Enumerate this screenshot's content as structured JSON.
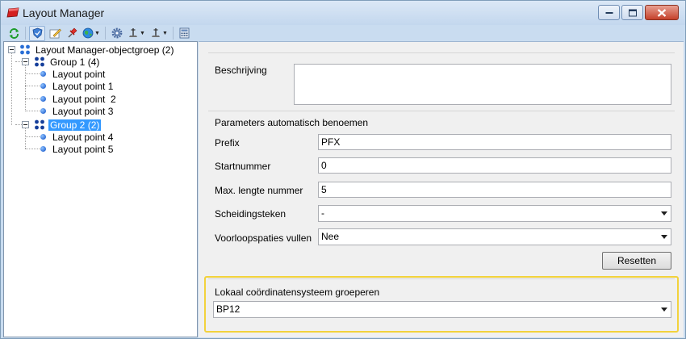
{
  "window": {
    "title": "Layout Manager",
    "icon": "layout-manager-app-icon"
  },
  "toolbar": {
    "buttons": [
      {
        "icon": "refresh-icon"
      },
      {
        "icon": "shield-icon",
        "active": true
      },
      {
        "icon": "edit-icon"
      },
      {
        "icon": "pin-icon"
      },
      {
        "icon": "globe-icon",
        "dropdown": true
      },
      {
        "icon": "gear-icon"
      },
      {
        "icon": "anchor-point-icon",
        "dropdown": true
      },
      {
        "icon": "anchor-point-icon",
        "dropdown": true
      },
      {
        "icon": "calculator-icon"
      }
    ]
  },
  "tree": {
    "root": "Layout Manager-objectgroep (2)",
    "group1": "Group 1 (4)",
    "group1_items": [
      "Layout point",
      "Layout point 1",
      "Layout point  2",
      "Layout point 3"
    ],
    "group2": "Group 2 (2)",
    "group2_items": [
      "Layout point 4",
      "Layout point 5"
    ]
  },
  "form": {
    "description_label": "Beschrijving",
    "description_value": "",
    "auto_naming_title": "Parameters automatisch benoemen",
    "prefix_label": "Prefix",
    "prefix_value": "PFX",
    "start_label": "Startnummer",
    "start_value": "0",
    "maxlen_label": "Max. lengte nummer",
    "maxlen_value": "5",
    "separator_label": "Scheidingsteken",
    "separator_value": "-",
    "padding_label": "Voorloopspaties vullen",
    "padding_value": "Nee",
    "reset_label": "Resetten",
    "coord_title": "Lokaal coördinatensysteem groeperen",
    "coord_value": "BP12"
  },
  "colors": {
    "selection": "#3399ff",
    "highlight": "#f2d23c",
    "close_button": "#c5412b"
  }
}
